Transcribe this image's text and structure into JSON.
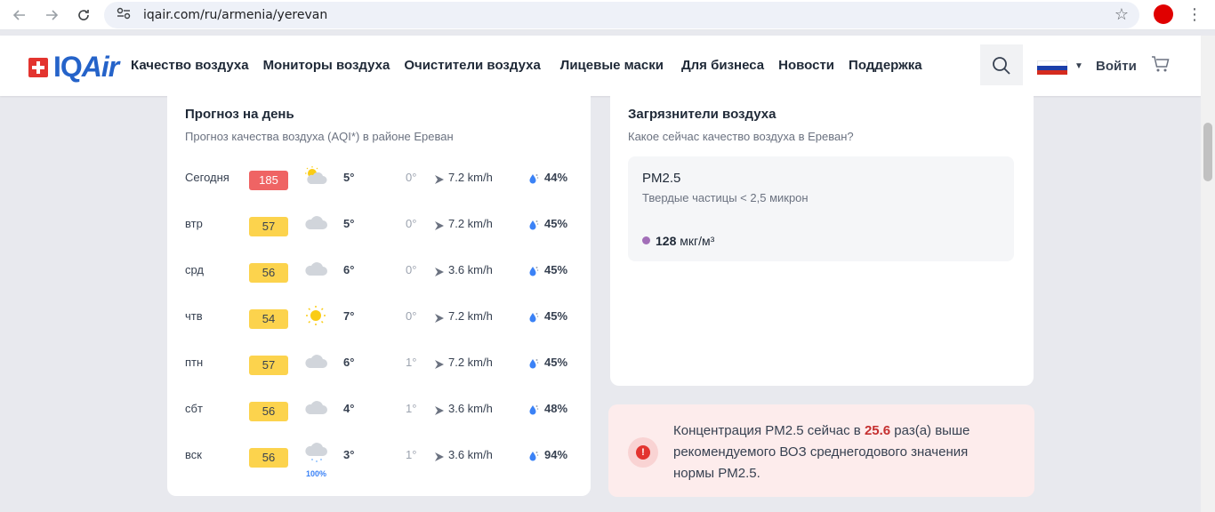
{
  "browser": {
    "url": "iqair.com/ru/armenia/yerevan"
  },
  "header": {
    "logo_text_iq": "IQ",
    "logo_text_air": "Air",
    "nav": [
      "Качество воздуха",
      "Мониторы воздуха",
      "Очистители воздуха",
      "Лицевые маски",
      "Для бизнеса",
      "Новости",
      "Поддержка"
    ],
    "login_label": "Войти"
  },
  "forecast": {
    "title": "Прогноз на день",
    "subtitle": "Прогноз качества воздуха (AQI*) в районе Ереван",
    "days": [
      {
        "day": "Сегодня",
        "aqi": "185",
        "aqi_color": "#ef6464",
        "aqi_text": "#ffffff",
        "weather": "partly-sunny-icon",
        "temp": "5°",
        "precip": "0°",
        "wind": "7.2 km/h",
        "humidity": "44%"
      },
      {
        "day": "втр",
        "aqi": "57",
        "aqi_color": "#fcd34d",
        "aqi_text": "#374151",
        "weather": "cloud-icon",
        "temp": "5°",
        "precip": "0°",
        "wind": "7.2 km/h",
        "humidity": "45%"
      },
      {
        "day": "срд",
        "aqi": "56",
        "aqi_color": "#fcd34d",
        "aqi_text": "#374151",
        "weather": "cloud-icon",
        "temp": "6°",
        "precip": "0°",
        "wind": "3.6 km/h",
        "humidity": "45%"
      },
      {
        "day": "чтв",
        "aqi": "54",
        "aqi_color": "#fcd34d",
        "aqi_text": "#374151",
        "weather": "sun-icon",
        "temp": "7°",
        "precip": "0°",
        "wind": "7.2 km/h",
        "humidity": "45%"
      },
      {
        "day": "птн",
        "aqi": "57",
        "aqi_color": "#fcd34d",
        "aqi_text": "#374151",
        "weather": "cloud-icon",
        "temp": "6°",
        "precip": "1°",
        "wind": "7.2 km/h",
        "humidity": "45%"
      },
      {
        "day": "сбт",
        "aqi": "56",
        "aqi_color": "#fcd34d",
        "aqi_text": "#374151",
        "weather": "cloud-icon",
        "temp": "4°",
        "precip": "1°",
        "wind": "3.6 km/h",
        "humidity": "48%"
      },
      {
        "day": "вск",
        "aqi": "56",
        "aqi_color": "#fcd34d",
        "aqi_text": "#374151",
        "weather": "snow-cloud-icon",
        "temp": "3°",
        "precip": "1°",
        "wind": "3.6 km/h",
        "humidity": "94%",
        "rain_chance": "100%"
      }
    ]
  },
  "pollutants": {
    "title": "Загрязнители воздуха",
    "subtitle": "Какое сейчас качество воздуха в Ереван?",
    "pm_name": "PM2.5",
    "pm_desc": "Твердые частицы < 2,5 микрон",
    "pm_value": "128",
    "pm_unit": "мкг/м³",
    "pm_color": "#a26eb8"
  },
  "alert": {
    "text_before": "Концентрация PM2.5 сейчас в ",
    "ratio": "25.6",
    "text_after": " раз(а) выше рекомендуемого ВОЗ среднегодового значения нормы PM2.5."
  }
}
